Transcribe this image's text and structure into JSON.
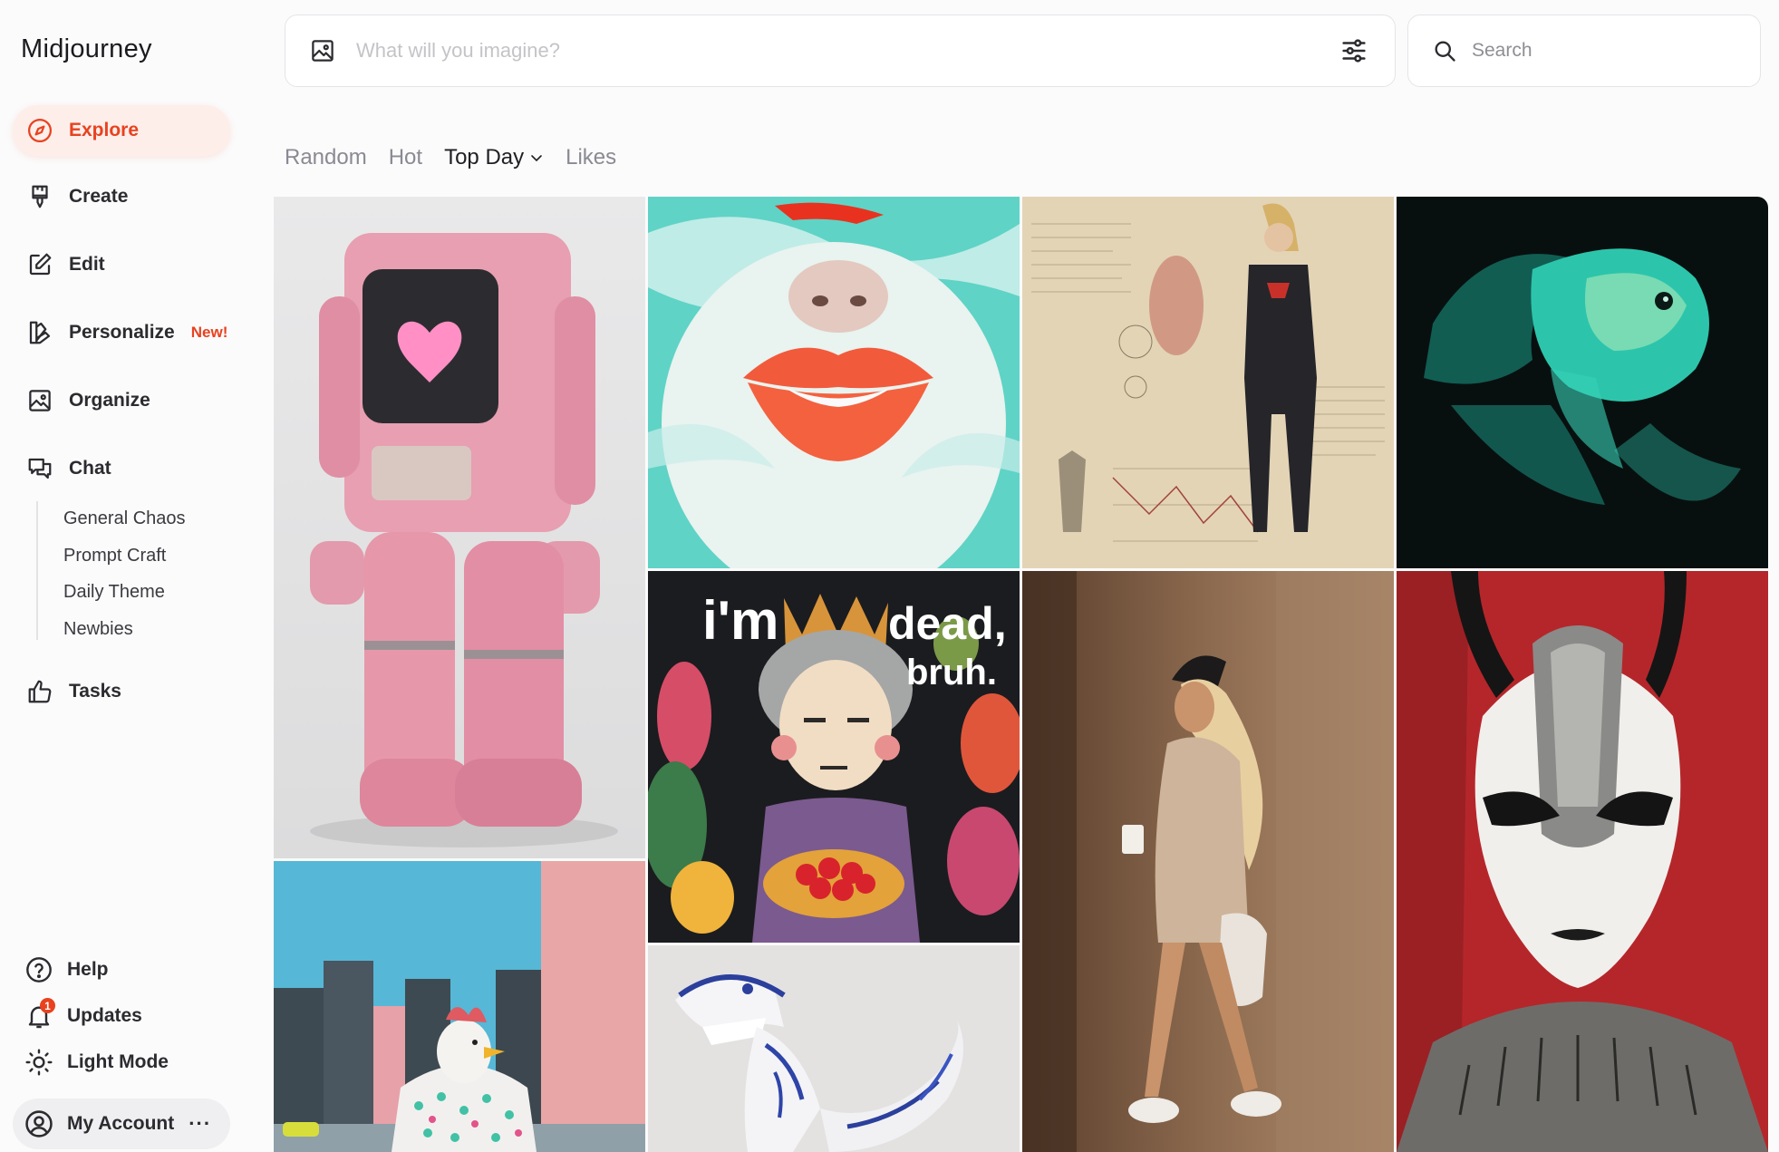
{
  "app": {
    "title": "Midjourney"
  },
  "nav": {
    "explore": "Explore",
    "create": "Create",
    "edit": "Edit",
    "personalize": "Personalize",
    "personalize_badge": "New!",
    "organize": "Organize",
    "chat": "Chat",
    "chat_channels": [
      "General Chaos",
      "Prompt Craft",
      "Daily Theme",
      "Newbies"
    ],
    "tasks": "Tasks"
  },
  "bottom": {
    "help": "Help",
    "updates": "Updates",
    "updates_count": "1",
    "light_mode": "Light Mode",
    "account": "My Account",
    "account_more": "···"
  },
  "imagine": {
    "placeholder": "What will you imagine?"
  },
  "search": {
    "placeholder": "Search"
  },
  "tabs": {
    "random": "Random",
    "hot": "Hot",
    "top_day": "Top Day",
    "likes": "Likes"
  },
  "gallery": {
    "tiles": [
      "pink-robot-image",
      "underwater-lips-image",
      "superhero-blueprint-image",
      "glowing-betta-fish-image",
      "felt-queen-dead-bruh-image",
      "fashion-walk-coffee-image",
      "masked-warrior-image",
      "pastel-city-chicken-image",
      "porcelain-dinosaur-image"
    ],
    "felt_text": [
      "i'm",
      "dead,",
      "bruh."
    ]
  },
  "colors": {
    "accent": "#e8421f",
    "active_bg": "#fdeeea",
    "background": "#fbfbfb"
  }
}
